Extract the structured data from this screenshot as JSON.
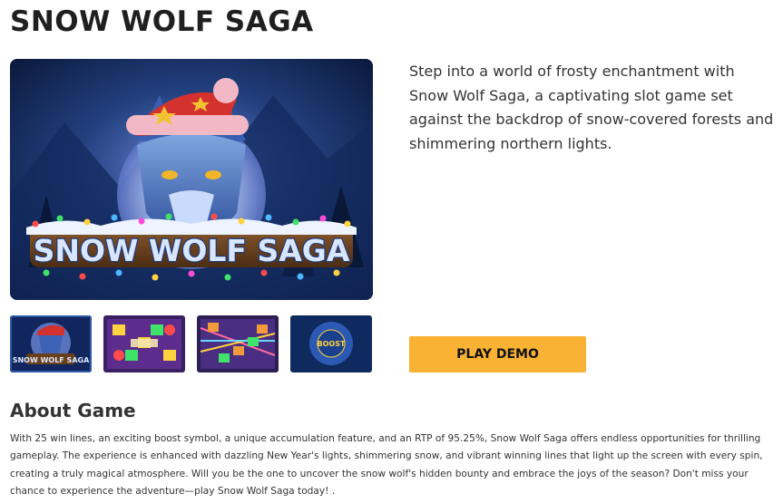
{
  "game": {
    "title": "SNOW WOLF SAGA",
    "description": "Step into a world of frosty enchantment with Snow Wolf Saga, a captivating slot game set against the backdrop of snow-covered forests and shimmering northern lights.",
    "hero_logo_text": "SNOW WOLF SAGA"
  },
  "thumbnails": [
    {
      "name": "thumb-cover",
      "text": "SNOW WOLF SAGA",
      "active": true
    },
    {
      "name": "thumb-reels-1",
      "text": "",
      "active": false
    },
    {
      "name": "thumb-reels-2",
      "text": "",
      "active": false
    },
    {
      "name": "thumb-boost",
      "text": "BOOST",
      "active": false
    }
  ],
  "actions": {
    "play_demo_label": "PLAY DEMO"
  },
  "about": {
    "heading": "About Game",
    "text": "With 25 win lines, an exciting boost symbol, a unique accumulation feature, and an RTP of 95.25%, Snow Wolf Saga offers endless opportunities for thrilling gameplay. The experience is enhanced with dazzling New Year's lights, shimmering snow, and vibrant winning lines that light up the screen with every spin, creating a truly magical atmosphere. Will you be the one to uncover the snow wolf's hidden bounty and embrace the joys of the season? Don't miss your chance to experience the adventure—play Snow Wolf Saga today! ."
  },
  "colors": {
    "accent": "#f9b233",
    "hero_bg": "#0b1e48",
    "text": "#333333"
  }
}
